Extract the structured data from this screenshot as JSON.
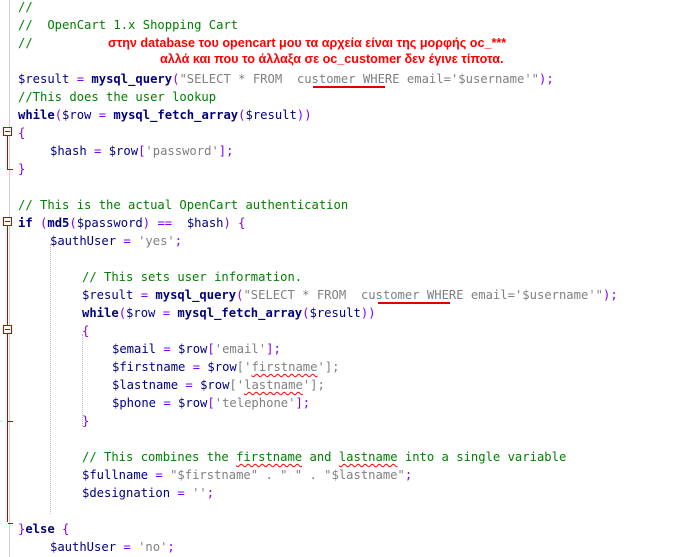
{
  "annotations": {
    "line1": "στην database του opencart μου τα αρχεία είναι της μορφής oc_***",
    "line2": "αλλά και που το άλλαξα σε oc_customer δεν έγινε τίποτα."
  },
  "code": {
    "l1": "//",
    "l2": "//  OpenCart 1.x Shopping Cart",
    "l3": "//",
    "l4_var": "$result",
    "l4_op": " = ",
    "l4_func": "mysql_query",
    "l4_p1": "(",
    "l4_str": "\"SELECT * FROM  customer WHERE email='$username'\"",
    "l4_p2": ");",
    "l5": "//This does the user lookup",
    "l6_kw": "while",
    "l6_p1": "(",
    "l6_var1": "$row",
    "l6_op": " = ",
    "l6_func": "mysql_fetch_array",
    "l6_p2": "(",
    "l6_var2": "$result",
    "l6_p3": "))",
    "l7": "{",
    "l8_var": "$hash",
    "l8_op": " = ",
    "l8_var2": "$row",
    "l8_p1": "[",
    "l8_str": "'password'",
    "l8_p2": "];",
    "l9": "}",
    "l11": "// This is the actual OpenCart authentication",
    "l12_kw": "if",
    "l12_p1": " (",
    "l12_func": "md5",
    "l12_p2": "(",
    "l12_var": "$password",
    "l12_op": ") ==  ",
    "l12_var2": "$hash",
    "l12_p3": ") {",
    "l13_var": "$authUser",
    "l13_op": " = ",
    "l13_str": "'yes'",
    "l13_p": ";",
    "l15": "// This sets user information.",
    "l16_var": "$result",
    "l16_op": " = ",
    "l16_func": "mysql_query",
    "l16_p1": "(",
    "l16_str": "\"SELECT * FROM  customer WHERE email='$username'\"",
    "l16_p2": ");",
    "l17_kw": "while",
    "l17_p1": "(",
    "l17_var1": "$row",
    "l17_op": " = ",
    "l17_func": "mysql_fetch_array",
    "l17_p2": "(",
    "l17_var2": "$result",
    "l17_p3": "))",
    "l18": "{",
    "l19_var": "$email",
    "l19_op": " = ",
    "l19_var2": "$row",
    "l19_p1": "[",
    "l19_str": "'email'",
    "l19_p2": "];",
    "l20_var": "$firstname",
    "l20_op": " = ",
    "l20_var2": "$row",
    "l20_p1": "['",
    "l20_str": "firstname",
    "l20_p2": "'];",
    "l21_var": "$lastname",
    "l21_op": " = ",
    "l21_var2": "$row",
    "l21_p1": "['",
    "l21_str": "lastname",
    "l21_p2": "'];",
    "l22_var": "$phone",
    "l22_op": " = ",
    "l22_var2": "$row",
    "l22_p1": "[",
    "l22_str": "'telephone'",
    "l22_p2": "];",
    "l23": "}",
    "l25_a": "// This combines the ",
    "l25_b": "firstname",
    "l25_c": " and ",
    "l25_d": "lastname",
    "l25_e": " into a single variable",
    "l26_var": "$fullname",
    "l26_op": " = ",
    "l26_str": "\"$firstname\" . \" \" . \"$lastname\"",
    "l26_p": ";",
    "l27_var": "$designation",
    "l27_op": " = ",
    "l27_str": "''",
    "l27_p": ";",
    "l29_a": "}",
    "l29_kw": "else",
    "l29_b": " {",
    "l30_var": "$authUser",
    "l30_op": " = ",
    "l30_str": "'no'",
    "l30_p": ";"
  }
}
